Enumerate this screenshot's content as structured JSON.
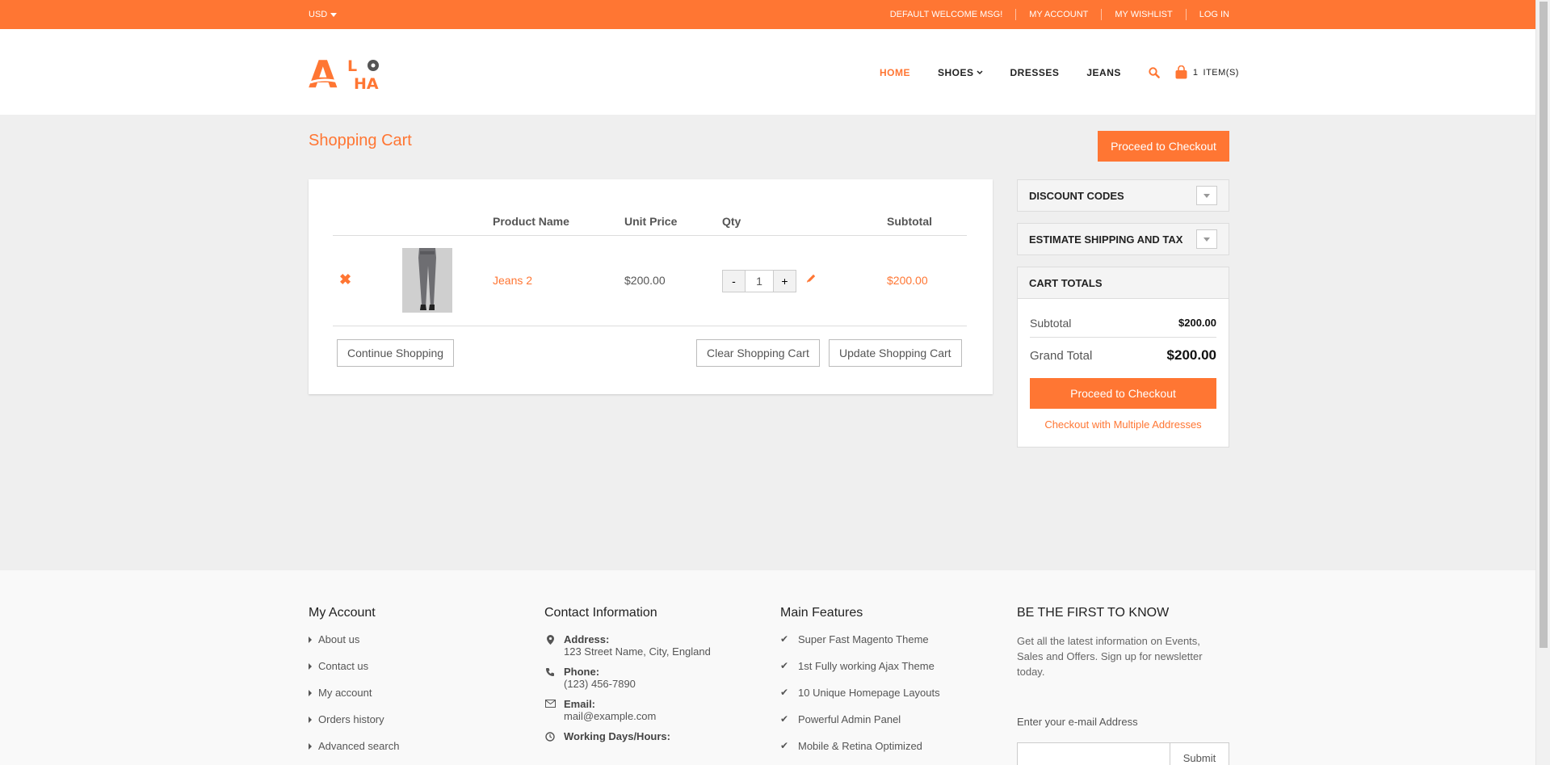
{
  "topbar": {
    "currency": "USD",
    "welcome": "DEFAULT WELCOME MSG!",
    "my_account": "MY ACCOUNT",
    "my_wishlist": "MY WISHLIST",
    "login": "LOG IN"
  },
  "brand": {
    "logo_top": "LO",
    "logo_bottom": "HA",
    "logo_big": "A",
    "color": "#ff7633"
  },
  "nav": {
    "home": "HOME",
    "shoes": "SHOES",
    "dresses": "DRESSES",
    "jeans": "JEANS",
    "cart_count": "1",
    "cart_label": "ITEM(S)"
  },
  "page": {
    "title": "Shopping Cart",
    "top_checkout": "Proceed to Checkout"
  },
  "cart": {
    "headers": {
      "name": "Product Name",
      "price": "Unit Price",
      "qty": "Qty",
      "subtotal": "Subtotal"
    },
    "items": [
      {
        "name": "Jeans 2",
        "price": "$200.00",
        "qty": "1",
        "subtotal": "$200.00"
      }
    ],
    "qty_minus": "-",
    "qty_plus": "+",
    "continue": "Continue Shopping",
    "clear": "Clear Shopping Cart",
    "update": "Update Shopping Cart"
  },
  "sidebar": {
    "discount": "DISCOUNT CODES",
    "shipping": "ESTIMATE SHIPPING AND TAX",
    "totals_title": "CART TOTALS",
    "subtotal_label": "Subtotal",
    "subtotal_value": "$200.00",
    "grand_label": "Grand Total",
    "grand_value": "$200.00",
    "checkout": "Proceed to Checkout",
    "multi": "Checkout with Multiple Addresses"
  },
  "footer": {
    "account": {
      "title": "My Account",
      "links": [
        "About us",
        "Contact us",
        "My account",
        "Orders history",
        "Advanced search"
      ]
    },
    "contact": {
      "title": "Contact Information",
      "address_label": "Address:",
      "address": "123 Street Name, City, England",
      "phone_label": "Phone:",
      "phone": "(123) 456-7890",
      "email_label": "Email:",
      "email": "mail@example.com",
      "hours_label": "Working Days/Hours:"
    },
    "features": {
      "title": "Main Features",
      "items": [
        "Super Fast Magento Theme",
        "1st Fully working Ajax Theme",
        "10 Unique Homepage Layouts",
        "Powerful Admin Panel",
        "Mobile & Retina Optimized"
      ]
    },
    "newsletter": {
      "title": "BE THE FIRST TO KNOW",
      "text": "Get all the latest information on Events, Sales and Offers. Sign up for newsletter today.",
      "label": "Enter your e-mail Address",
      "submit": "Submit"
    }
  }
}
